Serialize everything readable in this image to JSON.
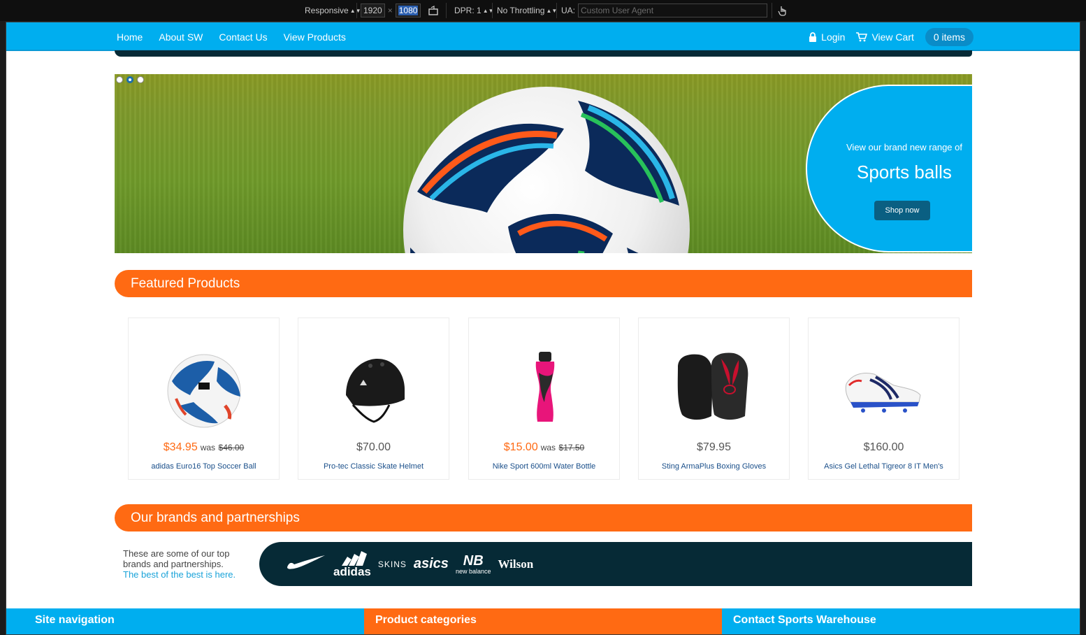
{
  "devtools": {
    "device": "Responsive",
    "width": "1920",
    "height": "1080",
    "dpr": "DPR: 1",
    "throttling": "No Throttling",
    "ua_label": "UA:",
    "ua_placeholder": "Custom User Agent"
  },
  "nav": {
    "links": [
      "Home",
      "About SW",
      "Contact Us",
      "View Products"
    ],
    "login": "Login",
    "view_cart": "View Cart",
    "cart_count": "0 items"
  },
  "hero": {
    "slides": 3,
    "active_slide": 2,
    "subtitle": "View our brand new range of",
    "title": "Sports balls",
    "cta": "Shop now"
  },
  "featured": {
    "heading": "Featured Products",
    "products": [
      {
        "price": "$34.95",
        "on_sale": true,
        "was_label": "was",
        "old_price": "$46.00",
        "name": "adidas Euro16 Top Soccer Ball",
        "image": "soccer-ball"
      },
      {
        "price": "$70.00",
        "on_sale": false,
        "was_label": "",
        "old_price": "",
        "name": "Pro-tec Classic Skate Helmet",
        "image": "helmet"
      },
      {
        "price": "$15.00",
        "on_sale": true,
        "was_label": "was",
        "old_price": "$17.50",
        "name": "Nike Sport 600ml Water Bottle",
        "image": "water-bottle"
      },
      {
        "price": "$79.95",
        "on_sale": false,
        "was_label": "",
        "old_price": "",
        "name": "Sting ArmaPlus Boxing Gloves",
        "image": "boxing-gloves"
      },
      {
        "price": "$160.00",
        "on_sale": false,
        "was_label": "",
        "old_price": "",
        "name": "Asics Gel Lethal Tigreor 8 IT Men's",
        "image": "football-boot"
      }
    ]
  },
  "brands": {
    "heading": "Our brands and partnerships",
    "text": "These are some of our top brands and partnerships.",
    "link": "The best of the best is here.",
    "logos": [
      "adidas",
      "SKINS",
      "asics",
      "new balance",
      "Wilson"
    ]
  },
  "footer": {
    "col1": "Site navigation",
    "col2": "Product categories",
    "col3": "Contact Sports Warehouse"
  },
  "colors": {
    "accent_blue": "#00aeef",
    "accent_orange": "#ff6a13",
    "dark_navy": "#062a36"
  }
}
